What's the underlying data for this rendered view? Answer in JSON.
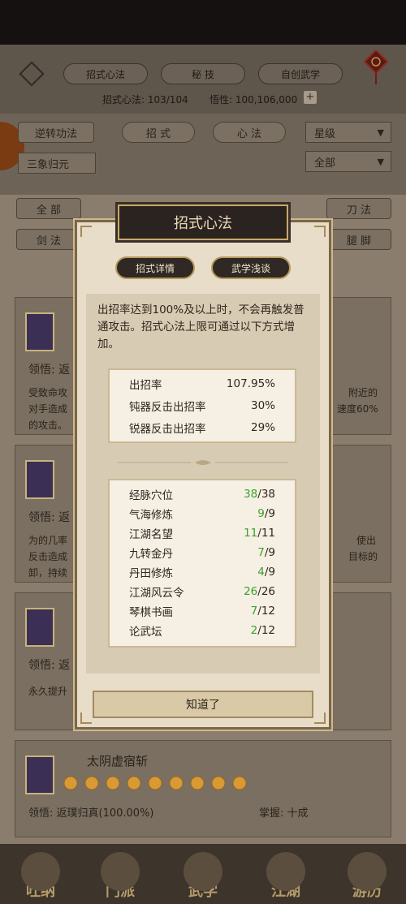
{
  "header": {
    "tabs": [
      "招式心法",
      "秘 技",
      "自创武学"
    ],
    "stat_label": "招式心法: 103/104",
    "wuxing_label": "悟性: 100,106,000",
    "plus": "+"
  },
  "filters": {
    "reverse": "逆转功法",
    "zhaoshi": "招 式",
    "xinfa": "心 法",
    "star_sort": "星级",
    "sanxiang": "三象归元",
    "all_select": "全部",
    "all_btn": "全 部",
    "dao": "刀 法",
    "jian": "剑 法",
    "tui": "腿 脚"
  },
  "cards": [
    {
      "realize": "领悟: 返",
      "text1": "受致命攻",
      "text2": "对手造成",
      "text3": "的攻击。",
      "right1": "附近的",
      "right2": "速度60%"
    },
    {
      "realize": "领悟: 返",
      "text1": "为的几率",
      "text2": "反击造成",
      "text3": "卸，持续",
      "right1": "使出",
      "right2": "目标的"
    },
    {
      "realize": "领悟: 返",
      "text1": "永久提升"
    },
    {
      "name": "太阴虚宿斩",
      "realize": "领悟: 返璞归真(100.00%)",
      "mastery": "掌握: 十成"
    }
  ],
  "nav": [
    "吐纳",
    "门派",
    "武学",
    "江湖",
    "游历"
  ],
  "modal": {
    "title": "招式心法",
    "tab_detail": "招式详情",
    "tab_talk": "武学浅谈",
    "description": "出招率达到100%及以上时，不会再触发普通攻击。招式心法上限可通过以下方式增加。",
    "rates": [
      {
        "label": "出招率",
        "value": "107.95%"
      },
      {
        "label": "钝器反击出招率",
        "value": "30%"
      },
      {
        "label": "锐器反击出招率",
        "value": "29%"
      }
    ],
    "sources": [
      {
        "label": "经脉穴位",
        "current": "38",
        "max": "/38"
      },
      {
        "label": "气海修炼",
        "current": "9",
        "max": "/9"
      },
      {
        "label": "江湖名望",
        "current": "11",
        "max": "/11"
      },
      {
        "label": "九转金丹",
        "current": "7",
        "max": "/9"
      },
      {
        "label": "丹田修炼",
        "current": "4",
        "max": "/9"
      },
      {
        "label": "江湖风云令",
        "current": "26",
        "max": "/26"
      },
      {
        "label": "琴棋书画",
        "current": "7",
        "max": "/12"
      },
      {
        "label": "论武坛",
        "current": "2",
        "max": "/12"
      }
    ],
    "ok": "知道了"
  }
}
